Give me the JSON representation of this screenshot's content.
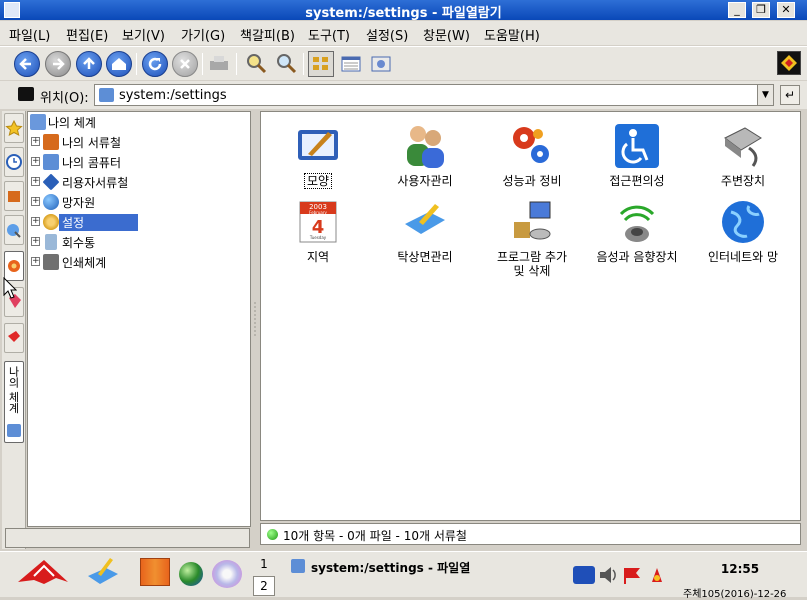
{
  "window": {
    "title": "system:/settings - 파일열람기",
    "controls": [
      "minimize",
      "maximize",
      "close"
    ]
  },
  "menubar": [
    "파일(L)",
    "편집(E)",
    "보기(V)",
    "가기(G)",
    "책갈피(B)",
    "도구(T)",
    "설정(S)",
    "창문(W)",
    "도움말(H)"
  ],
  "toolbar": {
    "buttons": [
      "back",
      "forward",
      "up",
      "home",
      "reload",
      "stop",
      "print",
      "zoom-in",
      "zoom-out",
      "icon-view",
      "detail-view",
      "preview-view"
    ]
  },
  "location": {
    "label": "위치(O):",
    "value": "system:/settings"
  },
  "tree": {
    "root": "나의 체계",
    "items": [
      {
        "label": "나의 서류철",
        "icon": "folder-icon",
        "color": "#d66a1c"
      },
      {
        "label": "나의 콤퓨터",
        "icon": "computer-icon",
        "color": "#5d8ed6"
      },
      {
        "label": "리용자서류철",
        "icon": "user-folder-icon",
        "color": "#2a5fb8"
      },
      {
        "label": "망자원",
        "icon": "network-icon",
        "color": "#2f7fd0"
      },
      {
        "label": "설정",
        "icon": "settings-icon",
        "color": "#d9a020",
        "selected": true
      },
      {
        "label": "회수통",
        "icon": "trash-icon",
        "color": "#9ab8d8"
      },
      {
        "label": "인쇄체계",
        "icon": "printer-icon",
        "color": "#707070"
      }
    ]
  },
  "side_tab_label": "나의 체계",
  "settings_items": [
    {
      "label": "모양",
      "icon": "appearance-icon",
      "focused": true
    },
    {
      "label": "사용자관리",
      "icon": "users-icon"
    },
    {
      "label": "성능과 정비",
      "icon": "performance-icon"
    },
    {
      "label": "접근편의성",
      "icon": "accessibility-icon"
    },
    {
      "label": "주변장치",
      "icon": "peripherals-icon"
    },
    {
      "label": "지역",
      "icon": "calendar-icon"
    },
    {
      "label": "탁상면관리",
      "icon": "desktop-icon"
    },
    {
      "label": "프로그람 추가\n및 삭제",
      "icon": "add-remove-icon"
    },
    {
      "label": "음성과 음향장치",
      "icon": "sound-icon"
    },
    {
      "label": "인터네트와 망",
      "icon": "internet-icon"
    }
  ],
  "calendar_icon": {
    "year": "2003",
    "month": "February",
    "day": "4",
    "weekday": "Tuesday"
  },
  "status": "10개 항목 - 0개 파일 - 10개 서류철",
  "taskbar": {
    "pages": [
      "1",
      "2"
    ],
    "active_task": "system:/settings - 파일열",
    "clock": "12:55",
    "date": "주체105(2016)-12-26"
  },
  "colors": {
    "titlebar": "#1a5cc8",
    "selection": "#3b6ccf",
    "background": "#e8e6e0"
  }
}
